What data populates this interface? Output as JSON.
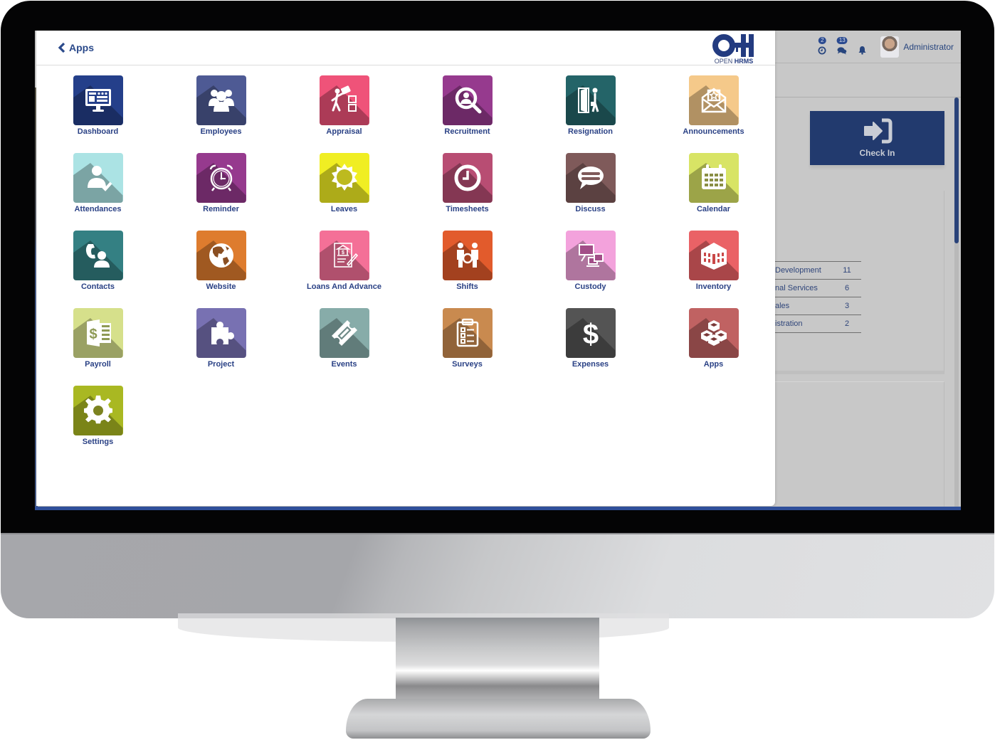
{
  "header": {
    "back_label": "Apps",
    "logo_top": "OH",
    "logo_open": "OPEN",
    "logo_hrms": "HRMS"
  },
  "systray": {
    "activities_count": "2",
    "messages_count": "13",
    "user_name": "Administrator"
  },
  "background": {
    "checkin_label": "Check In",
    "departments": [
      {
        "name": "Development",
        "count": "11"
      },
      {
        "name": "nal Services",
        "count": "6"
      },
      {
        "name": "ales",
        "count": "3"
      },
      {
        "name": "istration",
        "count": "2"
      }
    ]
  },
  "apps": [
    {
      "label": "Dashboard",
      "icon": "dashboard-icon",
      "color": "#243f8a"
    },
    {
      "label": "Employees",
      "icon": "employees-icon",
      "color": "#4e5a94"
    },
    {
      "label": "Appraisal",
      "icon": "appraisal-icon",
      "color": "#ef5379"
    },
    {
      "label": "Recruitment",
      "icon": "recruitment-icon",
      "color": "#963a8e"
    },
    {
      "label": "Resignation",
      "icon": "resignation-icon",
      "color": "#246468"
    },
    {
      "label": "Announcements",
      "icon": "announcements-icon",
      "color": "#f5c98a"
    },
    {
      "label": "Attendances",
      "icon": "attendances-icon",
      "color": "#abe3e4"
    },
    {
      "label": "Reminder",
      "icon": "reminder-icon",
      "color": "#963a8e"
    },
    {
      "label": "Leaves",
      "icon": "leaves-icon",
      "color": "#f0ee23"
    },
    {
      "label": "Timesheets",
      "icon": "timesheets-icon",
      "color": "#b84d73"
    },
    {
      "label": "Discuss",
      "icon": "discuss-icon",
      "color": "#7f5a5a"
    },
    {
      "label": "Calendar",
      "icon": "calendar-icon",
      "color": "#d8e465"
    },
    {
      "label": "Contacts",
      "icon": "contacts-icon",
      "color": "#348083"
    },
    {
      "label": "Website",
      "icon": "website-icon",
      "color": "#de7c2e"
    },
    {
      "label": "Loans And Advance",
      "icon": "loans-icon",
      "color": "#f47097"
    },
    {
      "label": "Shifts",
      "icon": "shifts-icon",
      "color": "#e25b2c"
    },
    {
      "label": "Custody",
      "icon": "custody-icon",
      "color": "#f3a2dc"
    },
    {
      "label": "Inventory",
      "icon": "inventory-icon",
      "color": "#ea6266"
    },
    {
      "label": "Payroll",
      "icon": "payroll-icon",
      "color": "#d6e08b"
    },
    {
      "label": "Project",
      "icon": "project-icon",
      "color": "#7871b2"
    },
    {
      "label": "Events",
      "icon": "events-icon",
      "color": "#87aca9"
    },
    {
      "label": "Surveys",
      "icon": "surveys-icon",
      "color": "#c98a4f"
    },
    {
      "label": "Expenses",
      "icon": "expenses-icon",
      "color": "#545454"
    },
    {
      "label": "Apps",
      "icon": "apps-icon",
      "color": "#c06262"
    },
    {
      "label": "Settings",
      "icon": "settings-icon",
      "color": "#a9b822"
    }
  ]
}
